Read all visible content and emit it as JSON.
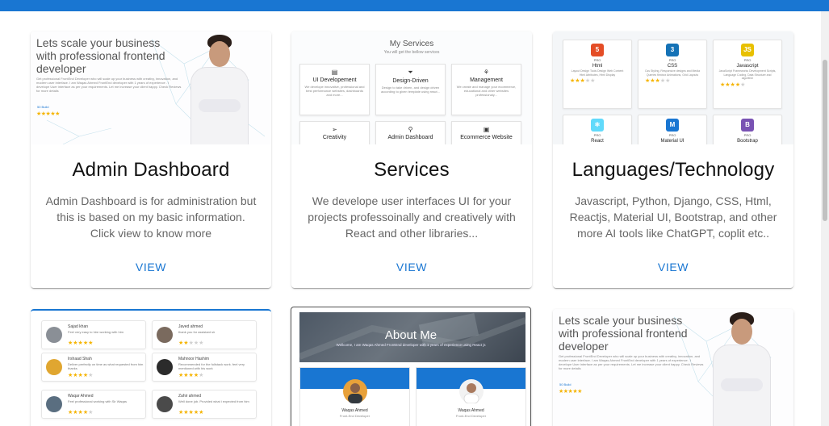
{
  "colors": {
    "accent": "#1976d2",
    "star": "#f5b400"
  },
  "cards": [
    {
      "title": "Admin Dashboard",
      "description": "Admin Dashboard is for administration but this is based on my basic information. Click view to know more",
      "action": "VIEW",
      "thumb": {
        "heading": "Lets scale your business with professional frontend developer",
        "sub": "Get professional FrontEnd Developer who will scale up your business with creativy, innovation, and modern user interface. I am Waqas Ahmed FrontEnd developer with 1 years of experience . I develope User interface as per your requirements. Let me increase your client happy. Check Reviews for more details",
        "badge": "50 Build",
        "stars": "★★★★★"
      }
    },
    {
      "title": "Services",
      "description": "We develope user interfaces UI for your projects professoinally and creatively with React and other libraries...",
      "action": "VIEW",
      "thumb": {
        "heading": "My Services",
        "sub": "You will get the bellow services",
        "items": [
          {
            "icon": "▤",
            "name": "UI Developement",
            "desc": "We develope innovative, professional and best performance websites, dashboards and more..."
          },
          {
            "icon": "⏷",
            "name": "Design-Driven",
            "desc": "Design to take driven, and design driven according to given template using react..."
          },
          {
            "icon": "⚘",
            "name": "Management",
            "desc": "We create and manage your ecommerce, educational and other websites professionaly..."
          },
          {
            "icon": "➢",
            "name": "Creativity",
            "desc": ""
          },
          {
            "icon": "⚲",
            "name": "Admin Dashboard",
            "desc": ""
          },
          {
            "icon": "▣",
            "name": "Ecommerce Website",
            "desc": ""
          }
        ]
      }
    },
    {
      "title": "Languages/Technology",
      "description": "Javascript, Python, Django, CSS, Html, Reactjs, Material UI, Bootstrap, and other more AI tools like ChatGPT, coplit etc..",
      "action": "VIEW",
      "thumb": {
        "items": [
          {
            "logo": "5",
            "color": "#e44d26",
            "level": "PRO",
            "name": "Html",
            "desc": "Layout Design Tools Design Web Content Html Attributes, Html Display",
            "stars": 3
          },
          {
            "logo": "3",
            "color": "#1572b6",
            "level": "PRO",
            "name": "CSS",
            "desc": "Css Styling, Responsive designs and Media Queries flexbox Animations, Grid Layouts",
            "stars": 3
          },
          {
            "logo": "JS",
            "color": "#e8c000",
            "level": "PRO",
            "name": "Javascript",
            "desc": "JavaScript Frameworks Development Scripts, Language Coding, Data Structure and algorithm",
            "stars": 4
          },
          {
            "logo": "⚛",
            "color": "#61dafb",
            "level": "PRO",
            "name": "React",
            "desc": "",
            "stars": 0
          },
          {
            "logo": "M",
            "color": "#1976d2",
            "level": "PRO",
            "name": "Material UI",
            "desc": "",
            "stars": 0
          },
          {
            "logo": "B",
            "color": "#7952b3",
            "level": "PRO",
            "name": "Bootstrap",
            "desc": "",
            "stars": 0
          }
        ]
      }
    }
  ],
  "reviews": [
    {
      "name": "Sajad khan",
      "text": "Feel very easy to hire working with him",
      "stars": 5,
      "avatar": "#8a8f96"
    },
    {
      "name": "Javed ahmed",
      "text": "thank you for assistant sir",
      "stars": 2,
      "avatar": "#7a6a5e"
    },
    {
      "name": "Irshaad Shah",
      "text": "Deliver perfectly on time as what requested from him thanks",
      "stars": 4,
      "avatar": "#e0a630"
    },
    {
      "name": "Mahnoor Hashim",
      "text": "Recommended for the fullstack work. feel very mentioned with his work",
      "stars": 4,
      "avatar": "#2b2b2b"
    },
    {
      "name": "Waqar Ahmed",
      "text": "Feel professional working with Sir Waqas",
      "stars": 4,
      "avatar": "#5a6e80"
    },
    {
      "name": "Zahir ahmed",
      "text": "Well done job. Provided what i expected from him",
      "stars": 5,
      "avatar": "#4a4a4a"
    }
  ],
  "about": {
    "title": "About Me",
    "sub": "Wellcome, I am Waqas Ahmed FrontEnd developer with 1 years of experience using React js",
    "profiles": [
      {
        "name": "Waqas Ahmed",
        "role": "Front-End Developer"
      },
      {
        "name": "Waqas Ahmed",
        "role": "Front-End Developer"
      }
    ]
  },
  "hero2": {
    "heading": "Lets scale your business with professional frontend developer",
    "sub": "Get professional FrontEnd Developer who will scale up your business with creativy, innovation, and modern user interface. I am Waqas Ahmed FrontEnd developer with 1 years of experience . I develope User interface as per your requirements. Let me increase your client happy. Check Reviews for more details",
    "badge": "50 Build",
    "stars": "★★★★★"
  }
}
